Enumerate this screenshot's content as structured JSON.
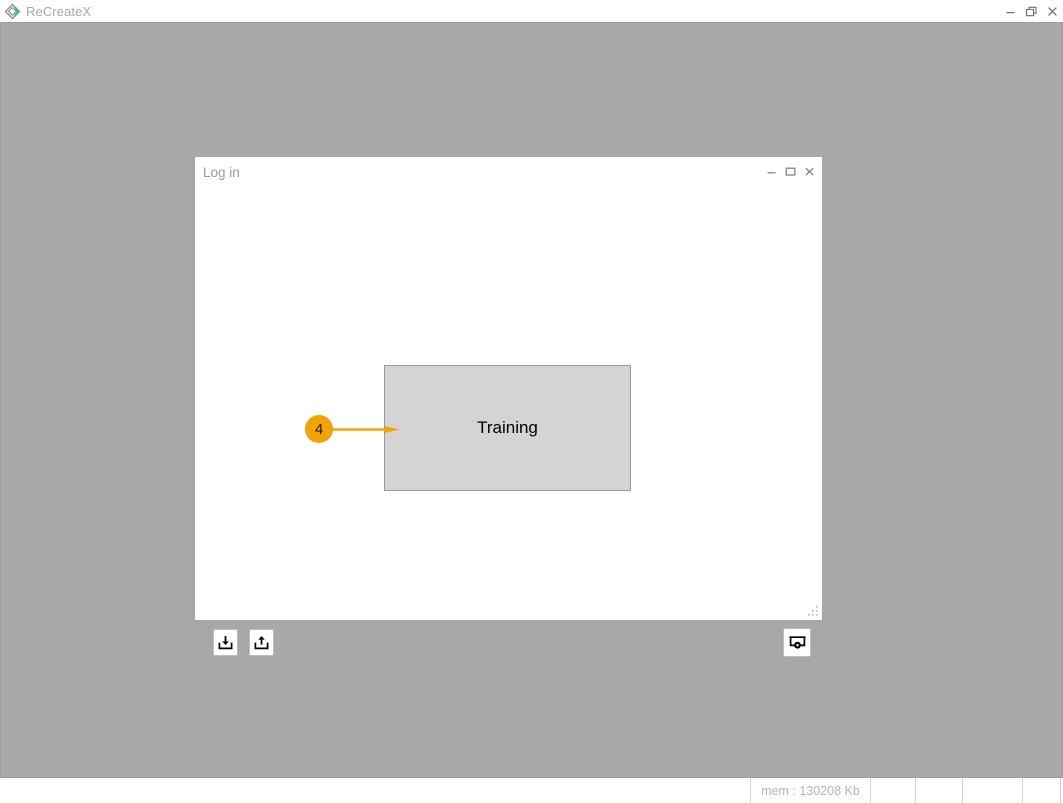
{
  "app": {
    "title": "ReCreateX",
    "logo_icon": "diamond-logo-icon",
    "window_controls": [
      {
        "name": "minimize",
        "icon": "minimize-icon"
      },
      {
        "name": "restore",
        "icon": "restore-icon"
      },
      {
        "name": "close",
        "icon": "close-icon"
      }
    ]
  },
  "dialog": {
    "title": "Log in",
    "window_controls": [
      {
        "name": "minimize",
        "icon": "minimize-icon"
      },
      {
        "name": "maximize",
        "icon": "maximize-icon"
      },
      {
        "name": "close",
        "icon": "close-icon"
      }
    ],
    "node": {
      "label": "Training"
    },
    "annotation": {
      "number": "4",
      "color": "#f5a300"
    },
    "footer": {
      "import_button": {
        "icon": "download-tray-icon",
        "label": ""
      },
      "export_button": {
        "icon": "upload-tray-icon",
        "label": ""
      },
      "preview_button": {
        "icon": "screen-record-icon",
        "label": ""
      }
    },
    "resize_grip_icon": "resize-grip-icon"
  },
  "status_bar": {
    "memory": "mem : 130208 Kb",
    "cell_2": "",
    "cell_3": "",
    "cell_4": "",
    "cell_5": "",
    "cell_6": ""
  },
  "colors": {
    "desktop": "#a8a8a8",
    "accent": "#f5a300",
    "node_fill": "#d4d4d4",
    "logo_green": "#2fc98a"
  }
}
